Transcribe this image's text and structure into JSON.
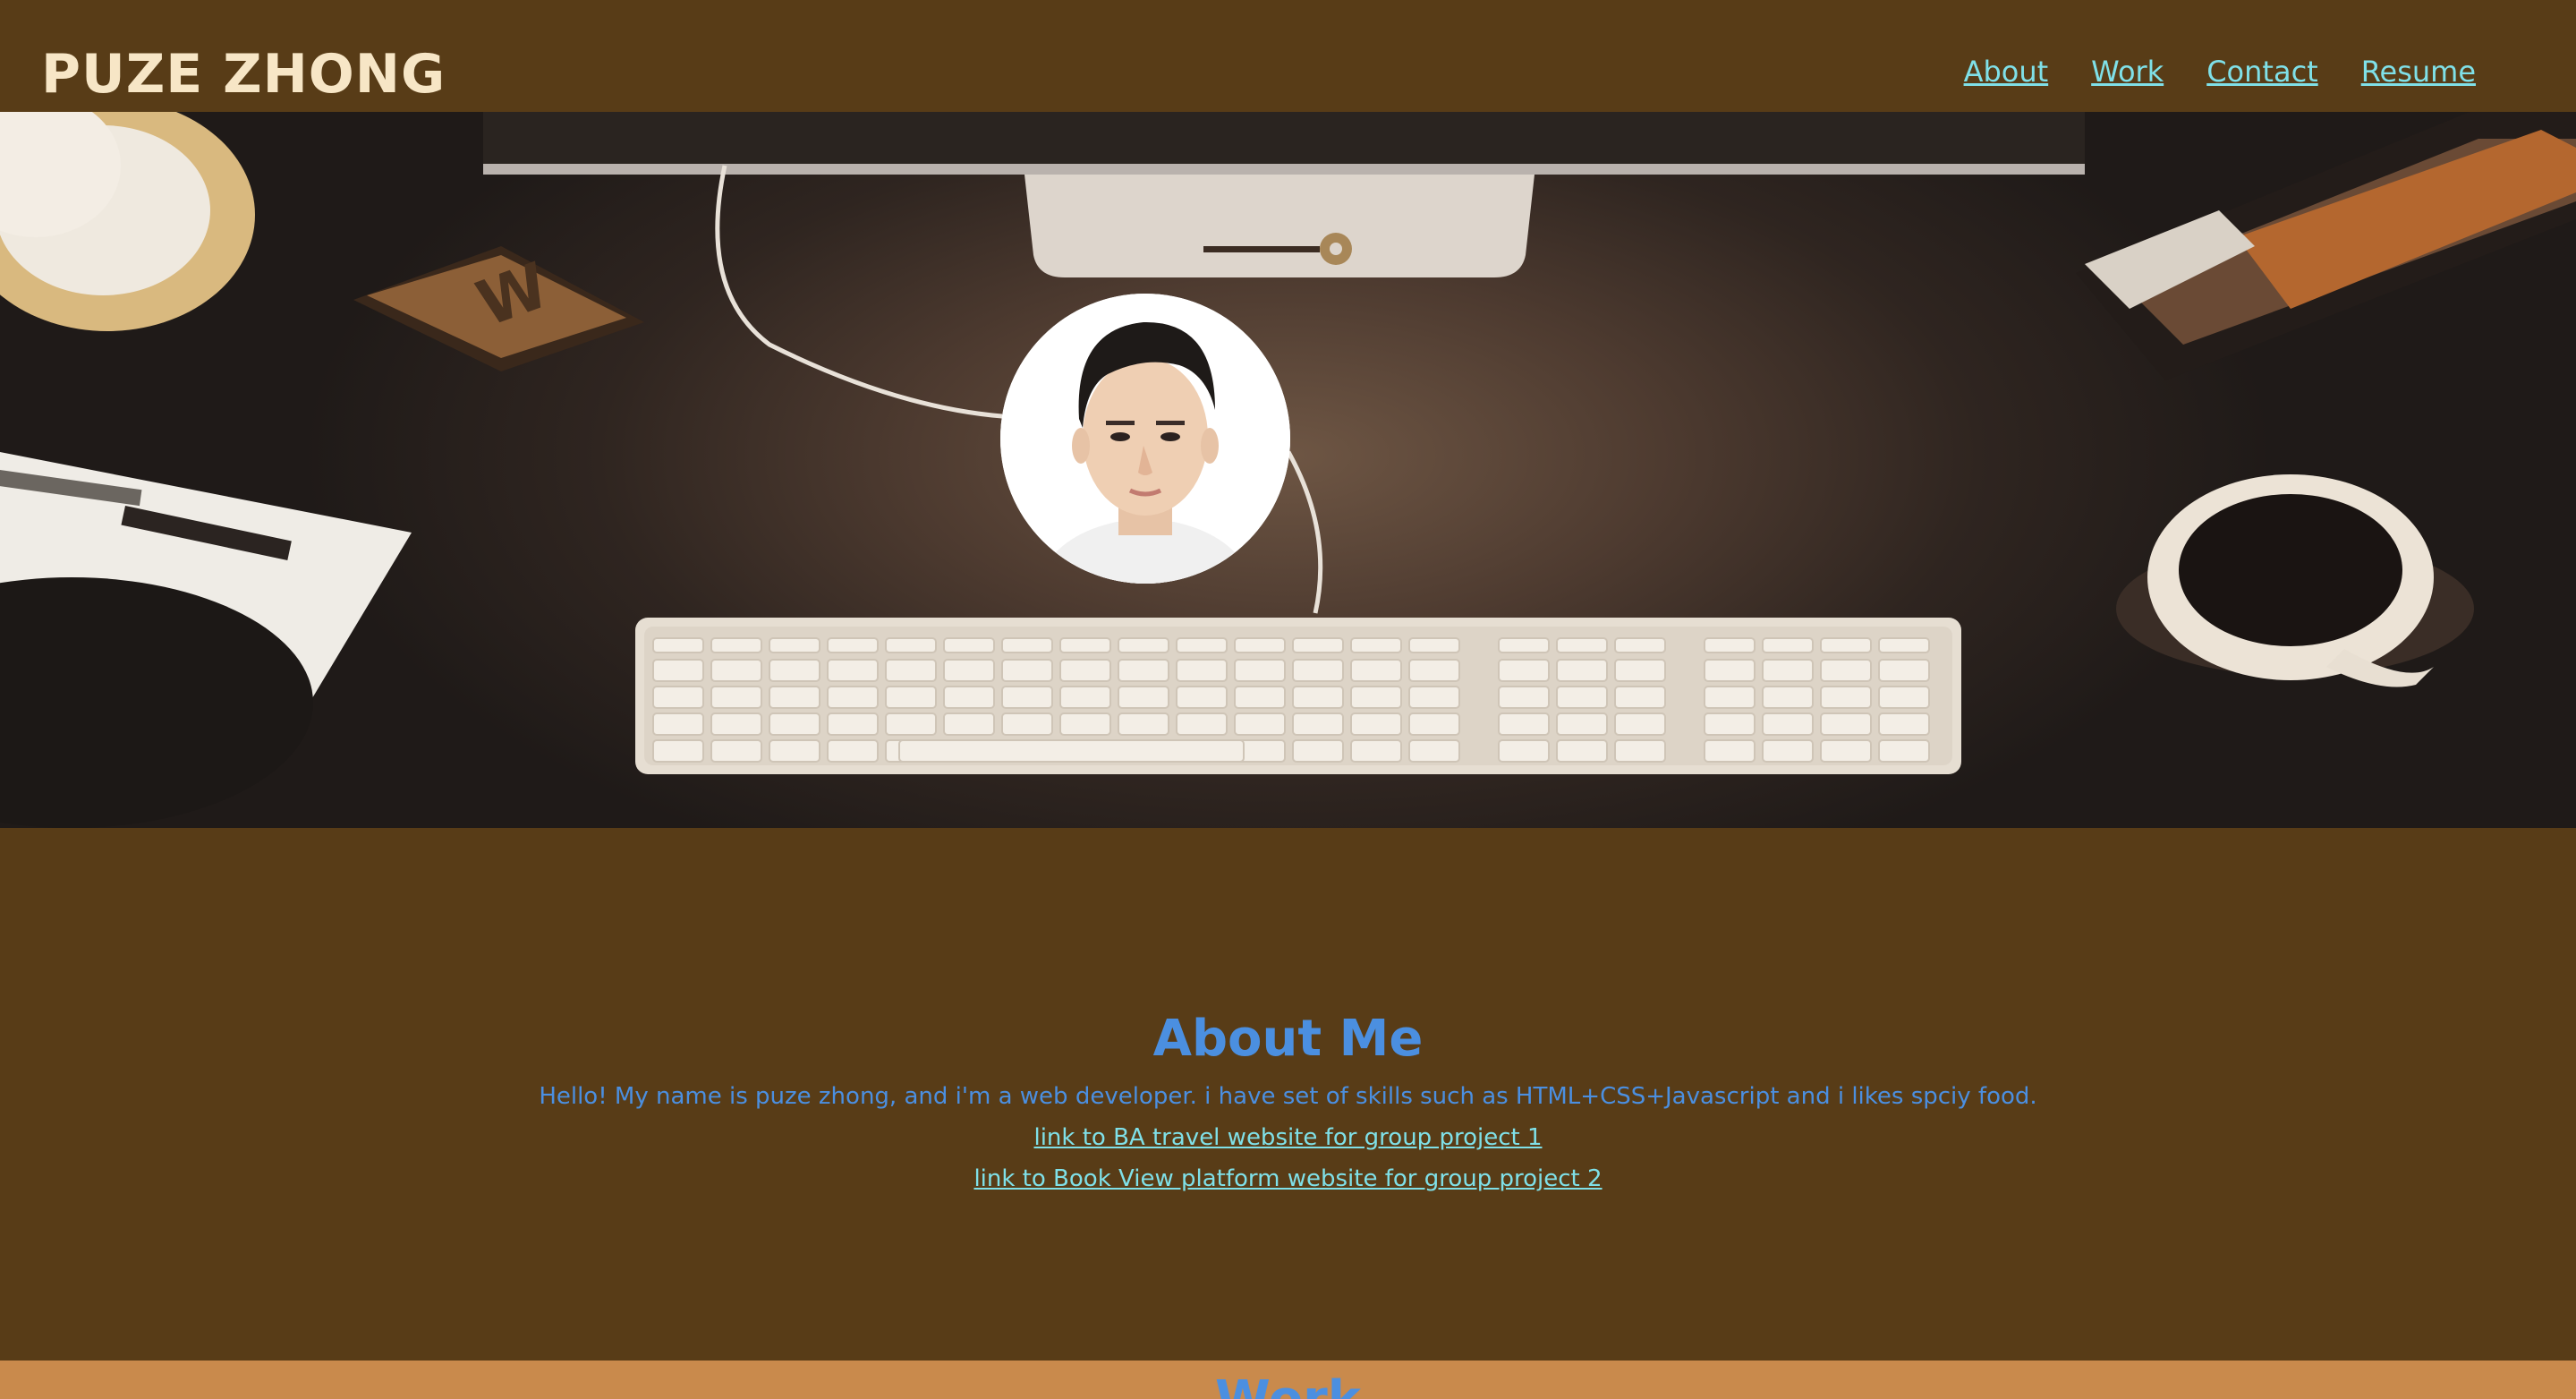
{
  "header": {
    "brand": "PUZE ZHONG",
    "nav": [
      {
        "label": "About"
      },
      {
        "label": "Work"
      },
      {
        "label": "Contact"
      },
      {
        "label": "Resume"
      }
    ]
  },
  "hero": {
    "image_description": "desk with monitor, keyboard, coffee cup and profile photo"
  },
  "about": {
    "title": "About Me",
    "text": "Hello! My name is puze zhong, and i'm a web developer. i have set of skills such as HTML+CSS+Javascript and i likes spciy food.",
    "links": [
      {
        "label": "link to BA travel website for group project 1"
      },
      {
        "label": "link to Book View platform website for group project 2"
      }
    ]
  },
  "work": {
    "title": "Work"
  },
  "colors": {
    "background": "#583c17",
    "brand": "#f7e6c6",
    "link": "#7fe0e8",
    "heading": "#4b8fe0",
    "work_band": "#c98a4c"
  }
}
